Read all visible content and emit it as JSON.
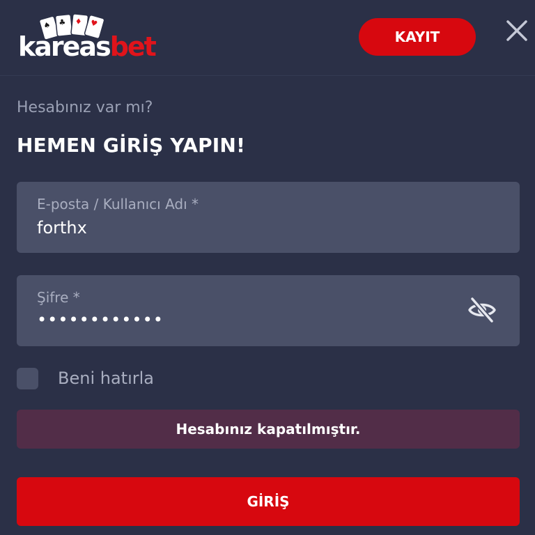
{
  "header": {
    "logo": {
      "text_main": "kareas",
      "text_accent": "bet",
      "brand_color": "#e0141b"
    },
    "register_label": "KAYIT",
    "close_icon": "close-icon"
  },
  "login": {
    "subtitle": "Hesabınız var mı?",
    "title": "HEMEN GİRİŞ YAPIN!",
    "username": {
      "label": "E-posta / Kullanıcı Adı *",
      "value": "forthx"
    },
    "password": {
      "label": "Şifre *",
      "value": "••••••••••••",
      "toggle_icon": "eye-slash-icon"
    },
    "remember_label": "Beni hatırla",
    "remember_checked": false,
    "error_message": "Hesabınız kapatılmıştır.",
    "submit_label": "GİRİŞ"
  },
  "colors": {
    "background": "#2b3047",
    "field": "#4a5068",
    "accent": "#d7080f",
    "alert_background": "#522d48"
  }
}
